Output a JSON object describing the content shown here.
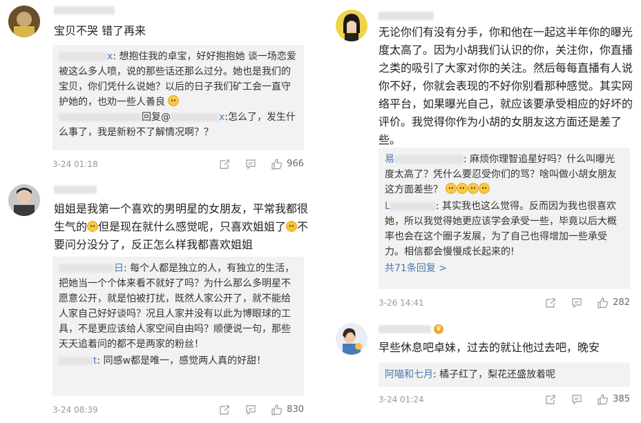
{
  "left": {
    "c1": {
      "text": "宝贝不哭 错了再来",
      "reply1_name": "x",
      "reply1_text": ": 想抱住我的卓宝，好好抱抱她 谈一场恋爱被这么多人喷，说的那些话还那么过分。她也是我们的宝贝，你们凭什么说她？以后的日子我们矿工会一直守护她的，也劝一些人善良",
      "reply2_mid": "回复@",
      "reply2_name": "x",
      "reply2_text": ":怎么了，发生什么事了，我是新粉不了解情况啊？？",
      "time": "3-24 01:18",
      "likes": "966"
    },
    "c2": {
      "text_a": "姐姐是我第一个喜欢的男明星的女朋友，平常我都很生气的",
      "text_b": "但是现在就什么感觉呢，只喜欢姐姐了",
      "text_c": "不要问分没分了，反正怎么样我都喜欢姐姐",
      "reply1_name": "日",
      "reply1_text": ": 每个人都是独立的人，有独立的生活，把她当一个个体来看不就好了吗？为什么那么多明星不愿意公开，就是怕被打扰，既然人家公开了，就不能给人家自己好好谈吗？况且人家并没有以此为博眼球的工具，不是更应该给人家空间自由吗？顺便说一句，那些天天追着问的都不是两家的粉丝！",
      "reply2_name": "t",
      "reply2_text": ": 同感w都是唯一，感觉两人真的好甜！",
      "time": "3-24 08:39",
      "likes": "830"
    }
  },
  "right": {
    "c3": {
      "text": "无论你们有没有分手，你和他在一起这半年你的曝光度太高了。因为小胡我们认识的你，关注你，你直播之类的吸引了大家对你的关注。然后每每直播有人说你不好，你就会表现的不好你别看那种感觉。其实网络平台，如果曝光自己，就应该要承受相应的好坏的评价。我觉得你作为小胡的女朋友这方面还是差了些。",
      "reply1_name": "易",
      "reply1_text": ": 麻烦你理智追星好吗？什么叫曝光度太高了？凭什么要忍受你们的骂？啥叫做小胡女朋友这方面差些？",
      "reply2_name": "L",
      "reply2_text": ": 其实我也这么觉得。反而因为我也很喜欢她，所以我觉得她更应该学会承受一些，毕竟以后大概率也会在这个圈子发展，为了自己也得增加一些承受力。相信都会慢慢成长起来的!",
      "more": "共71条回复 >",
      "time": "3-26 14:41",
      "likes": "282"
    },
    "c4": {
      "text": "早些休息吧卓妹，过去的就让他过去吧，晚安",
      "reply1_name": "阿喵和七月",
      "reply1_text": ": 橘子红了，梨花还盛放着呢",
      "time": "3-24 01:24",
      "likes": "385"
    }
  },
  "colors": {
    "link": "#4a77b3",
    "reply_bg": "#f2f2f2",
    "meta": "#999999"
  },
  "icons": [
    "share-icon",
    "comment-icon",
    "like-icon",
    "emoji-smile-icon",
    "vip-badge-icon"
  ]
}
